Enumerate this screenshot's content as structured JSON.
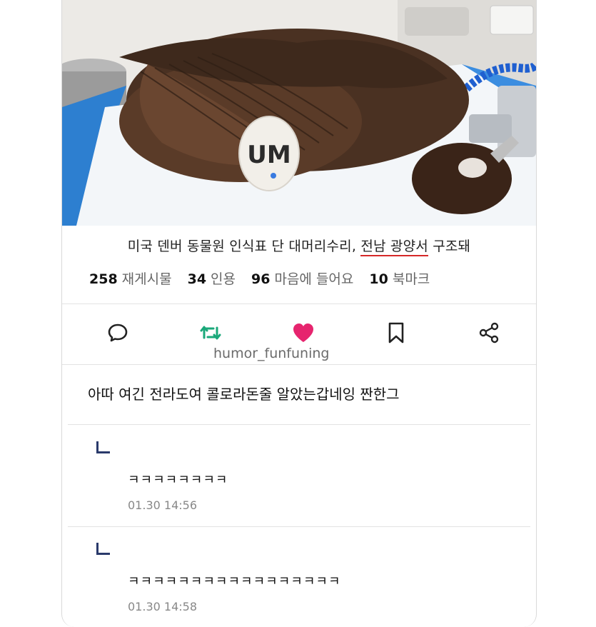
{
  "post": {
    "caption_before": "미국 덴버 동물원 인식표 단 대머리수리, ",
    "caption_highlight": "전남 광양서",
    "caption_after": " 구조돼",
    "tag_text": "UM"
  },
  "stats": [
    {
      "num": "258",
      "label": "재게시물"
    },
    {
      "num": "34",
      "label": "인용"
    },
    {
      "num": "96",
      "label": "마음에 들어요"
    },
    {
      "num": "10",
      "label": "북마크"
    }
  ],
  "actions": {
    "icons": [
      "comment-icon",
      "repost-icon",
      "heart-icon",
      "bookmark-icon",
      "share-icon"
    ],
    "colors": {
      "repost": "#1aa87a",
      "heart": "#e6246e",
      "default": "#222222"
    }
  },
  "watermark": "humor_funfuning",
  "comment": {
    "text": "아따 여긴 전라도여 콜로라돈줄 알았는갑네잉 짠한그"
  },
  "replies": [
    {
      "text": "ㅋㅋㅋㅋㅋㅋㅋㅋ",
      "time": "01.30 14:56"
    },
    {
      "text": "ㅋㅋㅋㅋㅋㅋㅋㅋㅋㅋㅋㅋㅋㅋㅋㅋㅋ",
      "time": "01.30 14:58"
    }
  ]
}
